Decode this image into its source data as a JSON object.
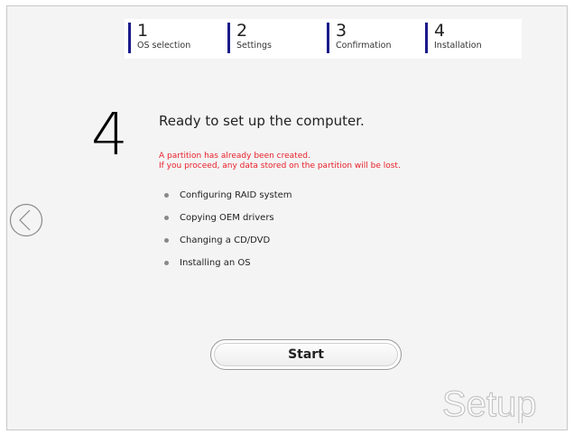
{
  "steps": [
    {
      "num": "1",
      "label": "OS selection"
    },
    {
      "num": "2",
      "label": "Settings"
    },
    {
      "num": "3",
      "label": "Confirmation"
    },
    {
      "num": "4",
      "label": "Installation"
    }
  ],
  "main": {
    "step_number": "4",
    "title": "Ready to set up the computer.",
    "warning_line1": "A partition has already been created.",
    "warning_line2": "If you proceed, any data stored on the partition will be lost.",
    "tasks": [
      "Configuring RAID system",
      "Copying OEM drivers",
      "Changing a CD/DVD",
      "Installing an OS"
    ]
  },
  "buttons": {
    "start_label": "Start",
    "back_icon": "chevron-left-circle-icon"
  },
  "logo": {
    "text": "Setup"
  },
  "colors": {
    "step_bar": "#1a1a8a",
    "warning": "#e8202a",
    "background": "#f4f4f4"
  }
}
